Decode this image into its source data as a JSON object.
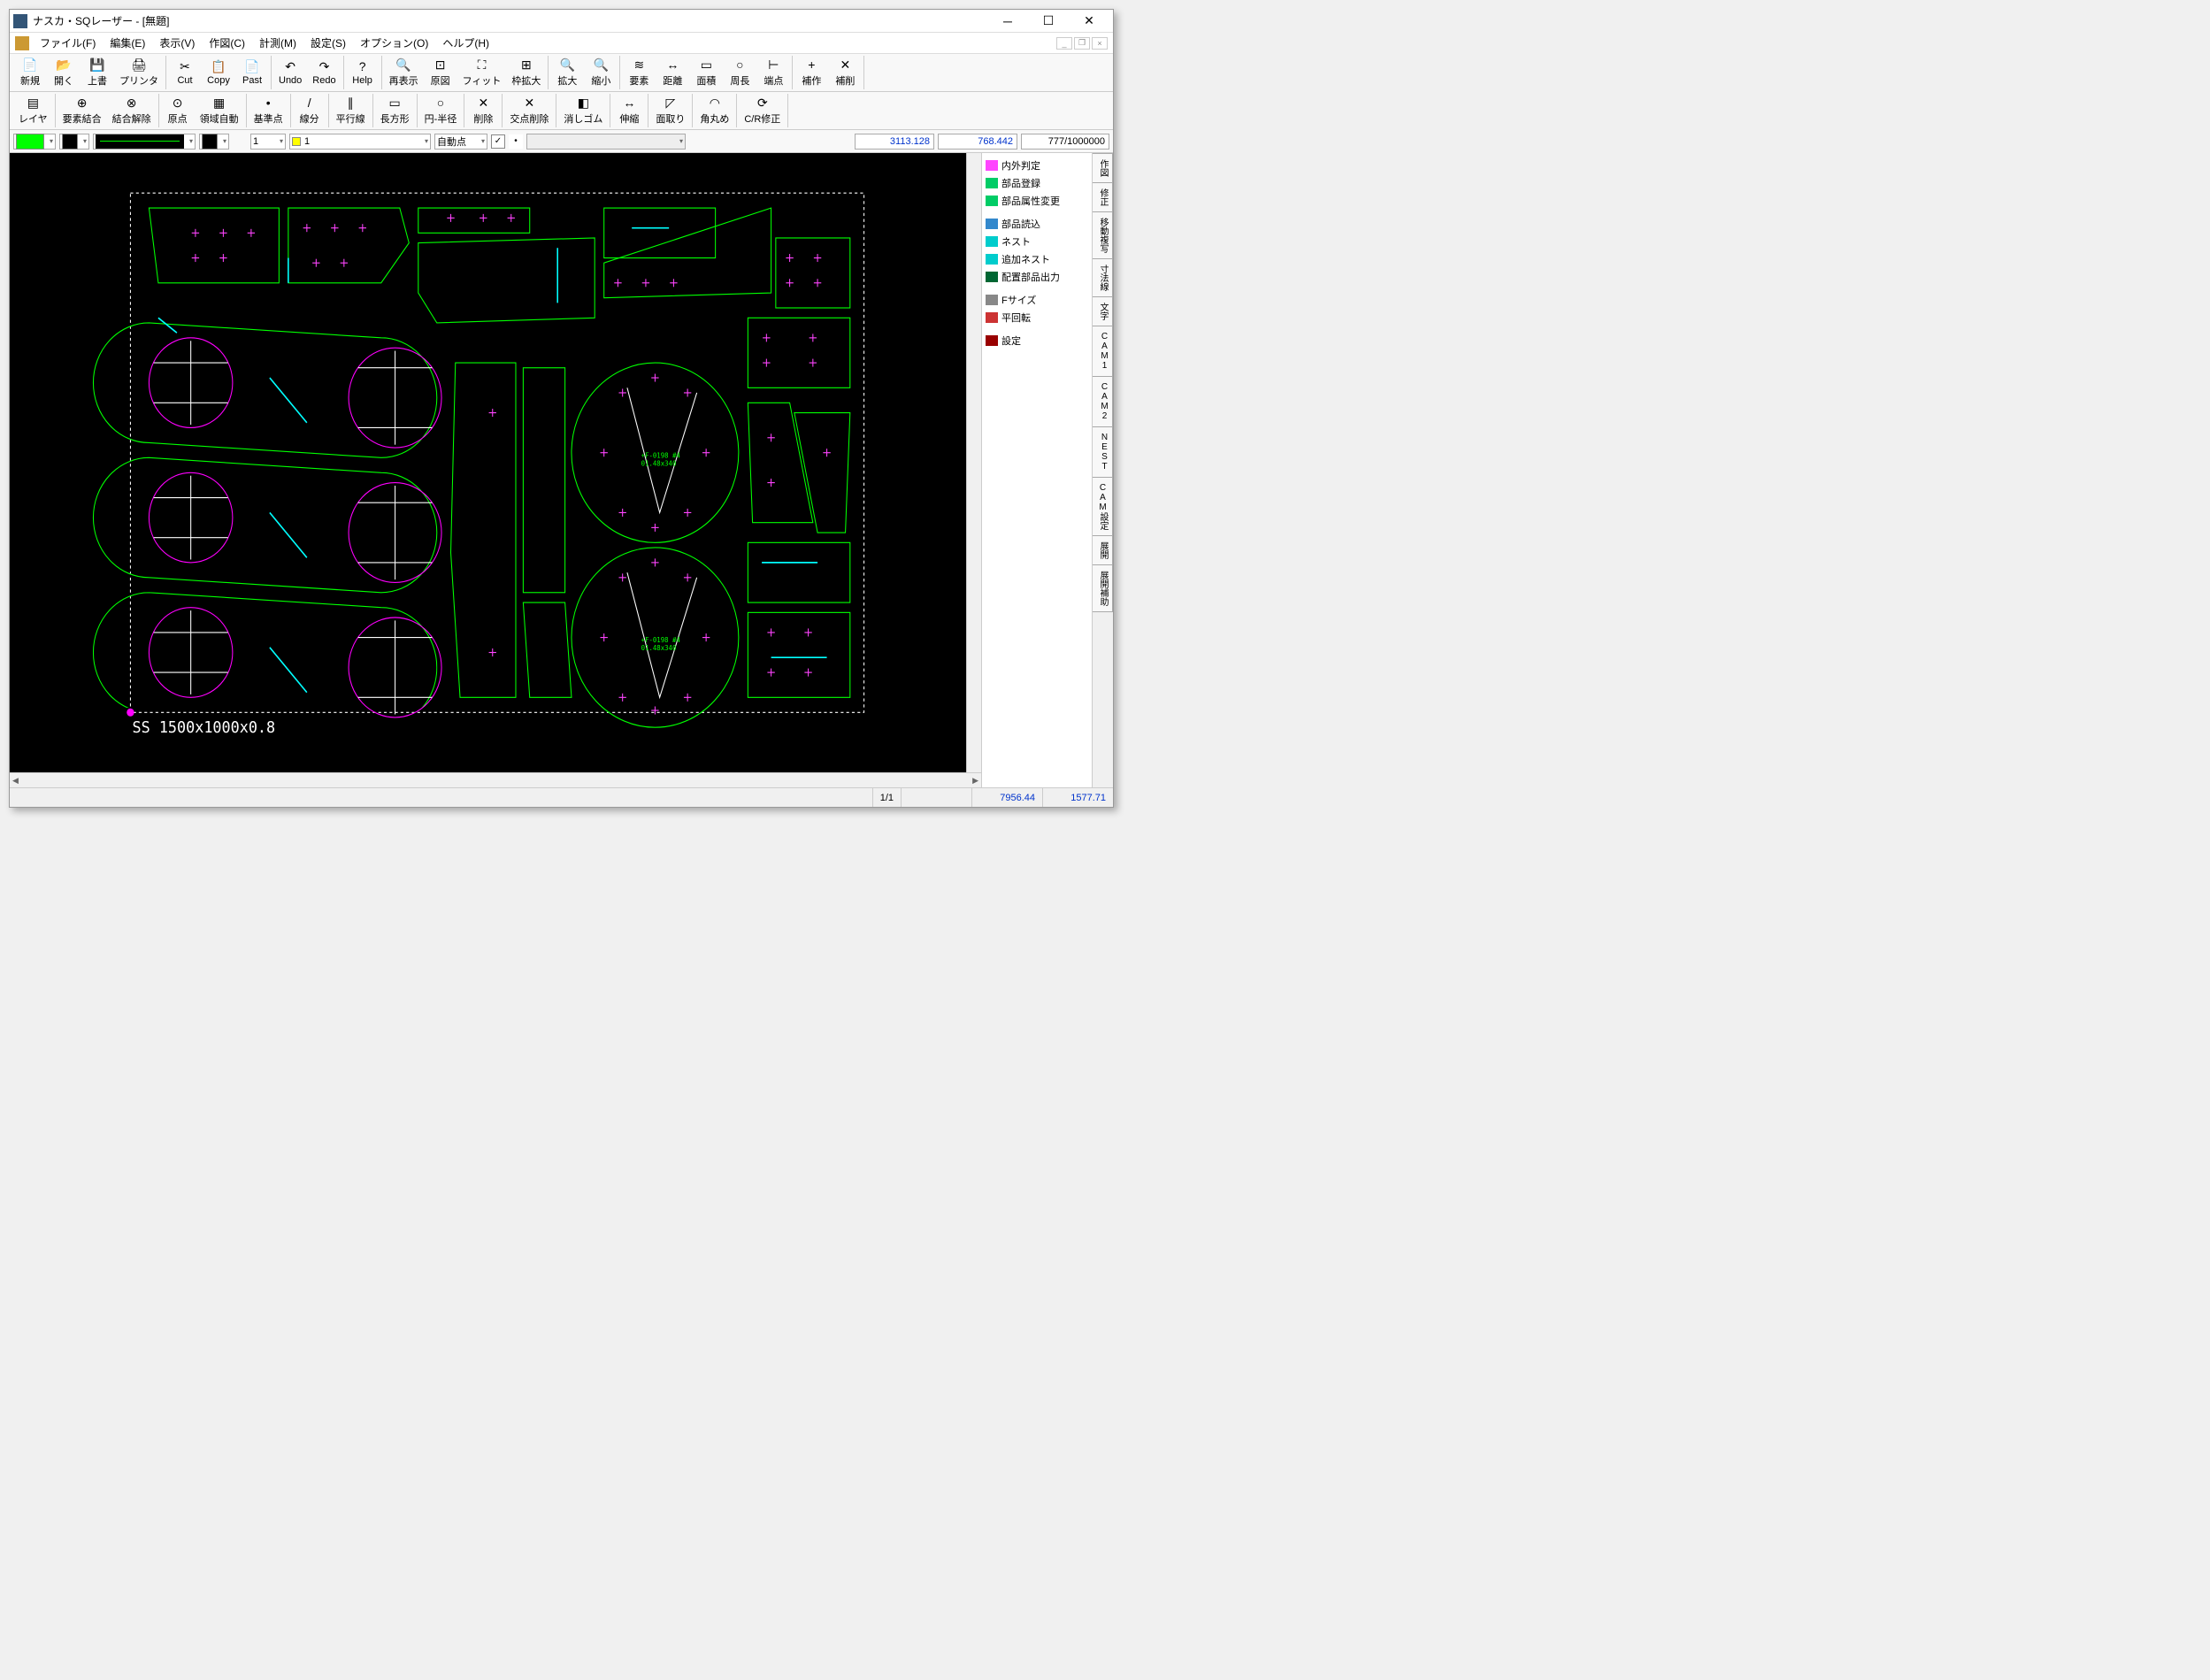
{
  "title": "ナスカ・SQレーザー - [無題]",
  "menus": [
    "ファイル(F)",
    "編集(E)",
    "表示(V)",
    "作図(C)",
    "計測(M)",
    "設定(S)",
    "オプション(O)",
    "ヘルプ(H)"
  ],
  "toolbar1": [
    [
      {
        "l": "新規",
        "i": "📄"
      },
      {
        "l": "開く",
        "i": "📂"
      },
      {
        "l": "上書",
        "i": "💾"
      },
      {
        "l": "プリンタ",
        "i": "🖨"
      }
    ],
    [
      {
        "l": "Cut",
        "i": "✂"
      },
      {
        "l": "Copy",
        "i": "📋"
      },
      {
        "l": "Past",
        "i": "📄"
      }
    ],
    [
      {
        "l": "Undo",
        "i": "↶"
      },
      {
        "l": "Redo",
        "i": "↷"
      }
    ],
    [
      {
        "l": "Help",
        "i": "?"
      }
    ],
    [
      {
        "l": "再表示",
        "i": "🔍"
      },
      {
        "l": "原図",
        "i": "⊡"
      },
      {
        "l": "フィット",
        "i": "⛶"
      },
      {
        "l": "枠拡大",
        "i": "⊞"
      }
    ],
    [
      {
        "l": "拡大",
        "i": "🔍"
      },
      {
        "l": "縮小",
        "i": "🔍"
      }
    ],
    [
      {
        "l": "要素",
        "i": "≋"
      },
      {
        "l": "距離",
        "i": "↔"
      },
      {
        "l": "面積",
        "i": "▭"
      },
      {
        "l": "周長",
        "i": "○"
      },
      {
        "l": "端点",
        "i": "⊢"
      }
    ],
    [
      {
        "l": "補作",
        "i": "+"
      },
      {
        "l": "補削",
        "i": "✕"
      }
    ]
  ],
  "toolbar2": [
    [
      {
        "l": "レイヤ",
        "i": "▤"
      }
    ],
    [
      {
        "l": "要素結合",
        "i": "⊕"
      },
      {
        "l": "結合解除",
        "i": "⊗"
      }
    ],
    [
      {
        "l": "原点",
        "i": "⊙"
      },
      {
        "l": "領域自動",
        "i": "▦"
      }
    ],
    [
      {
        "l": "基準点",
        "i": "•"
      }
    ],
    [
      {
        "l": "線分",
        "i": "/"
      }
    ],
    [
      {
        "l": "平行線",
        "i": "∥"
      }
    ],
    [
      {
        "l": "長方形",
        "i": "▭"
      }
    ],
    [
      {
        "l": "円-半径",
        "i": "○"
      }
    ],
    [
      {
        "l": "削除",
        "i": "✕"
      }
    ],
    [
      {
        "l": "交点削除",
        "i": "✕"
      }
    ],
    [
      {
        "l": "消しゴム",
        "i": "◧"
      }
    ],
    [
      {
        "l": "伸縮",
        "i": "↔"
      }
    ],
    [
      {
        "l": "面取り",
        "i": "◸"
      }
    ],
    [
      {
        "l": "角丸め",
        "i": "◠"
      }
    ],
    [
      {
        "l": "C/R修正",
        "i": "⟳"
      }
    ]
  ],
  "propbar": {
    "layer_num": "1",
    "layer_color": "1",
    "snap_mode": "自動点",
    "coord_x": "3113.128",
    "coord_y": "768.442",
    "ratio": "777/1000000"
  },
  "side_items": [
    {
      "l": "内外判定",
      "c": "#ff44ff"
    },
    {
      "l": "部品登録",
      "c": "#00cc66"
    },
    {
      "l": "部品属性変更",
      "c": "#00cc66"
    },
    {
      "sep": true
    },
    {
      "l": "部品読込",
      "c": "#3388cc"
    },
    {
      "l": "ネスト",
      "c": "#00cccc"
    },
    {
      "l": "追加ネスト",
      "c": "#00cccc"
    },
    {
      "l": "配置部品出力",
      "c": "#006633"
    },
    {
      "sep": true
    },
    {
      "l": "Fサイズ",
      "c": "#888"
    },
    {
      "l": "平回転",
      "c": "#cc3333"
    },
    {
      "sep": true
    },
    {
      "l": "設定",
      "c": "#990000"
    }
  ],
  "vtabs": [
    "作図",
    "修正",
    "移動複写",
    "寸法線",
    "文字",
    "CAM1",
    "CAM2",
    "NEST",
    "CAM設定",
    "展開",
    "展開補助"
  ],
  "status": {
    "page": "1/1",
    "x": "7956.44",
    "y": "1577.71"
  },
  "sheet_label": "SS 1500x1000x0.8"
}
